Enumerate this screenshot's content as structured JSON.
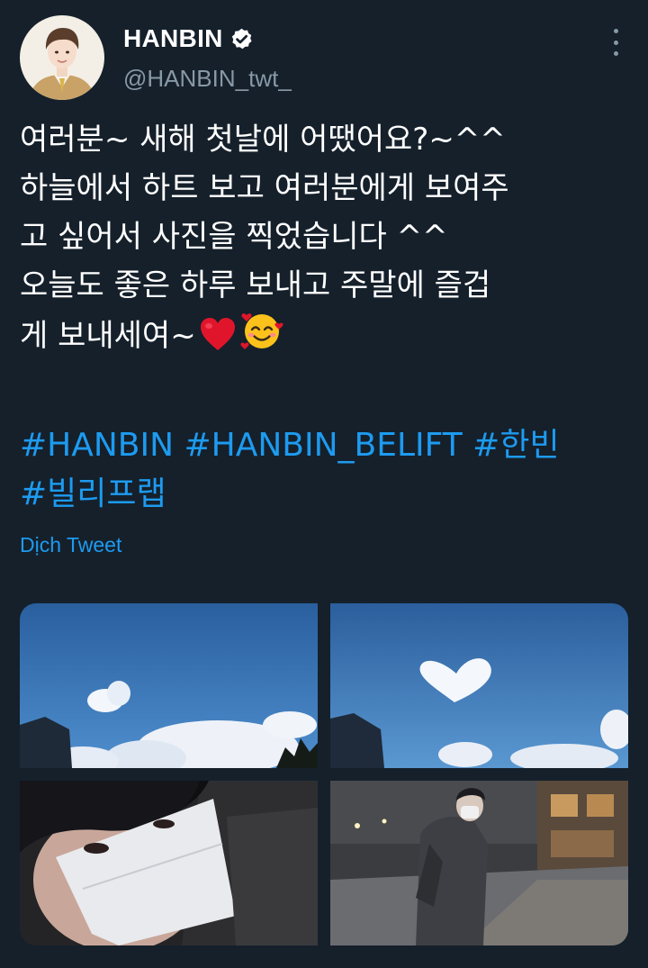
{
  "author": {
    "display_name": "HANBIN",
    "handle": "@HANBIN_twt_",
    "verified": true,
    "avatar_icon": "profile-photo"
  },
  "tweet": {
    "lines": [
      "여러분~ 새해 첫날에 어땠어요?~^^",
      "하늘에서 하트 보고 여러분에게 보여주",
      "고 싶어서 사진을 찍었습니다 ^^",
      "오늘도 좋은 하루 보내고 주말에 즐겁",
      "게 보내세여~"
    ],
    "emojis": [
      "red-heart-emoji",
      "smiling-face-with-hearts-emoji"
    ]
  },
  "hashtags": {
    "line1": [
      "#HANBIN",
      "#HANBIN_BELIFT",
      "#한빈"
    ],
    "line2": [
      "#빌리프랩"
    ]
  },
  "translate_label": "Dịch Tweet",
  "media": [
    {
      "name": "sky-heart-cloud-photo-1"
    },
    {
      "name": "sky-heart-cloud-photo-2"
    },
    {
      "name": "selfie-with-mask-photo"
    },
    {
      "name": "street-portrait-photo"
    }
  ],
  "colors": {
    "background": "#15202b",
    "link": "#1d9bf0",
    "secondary_text": "#8899a6"
  }
}
